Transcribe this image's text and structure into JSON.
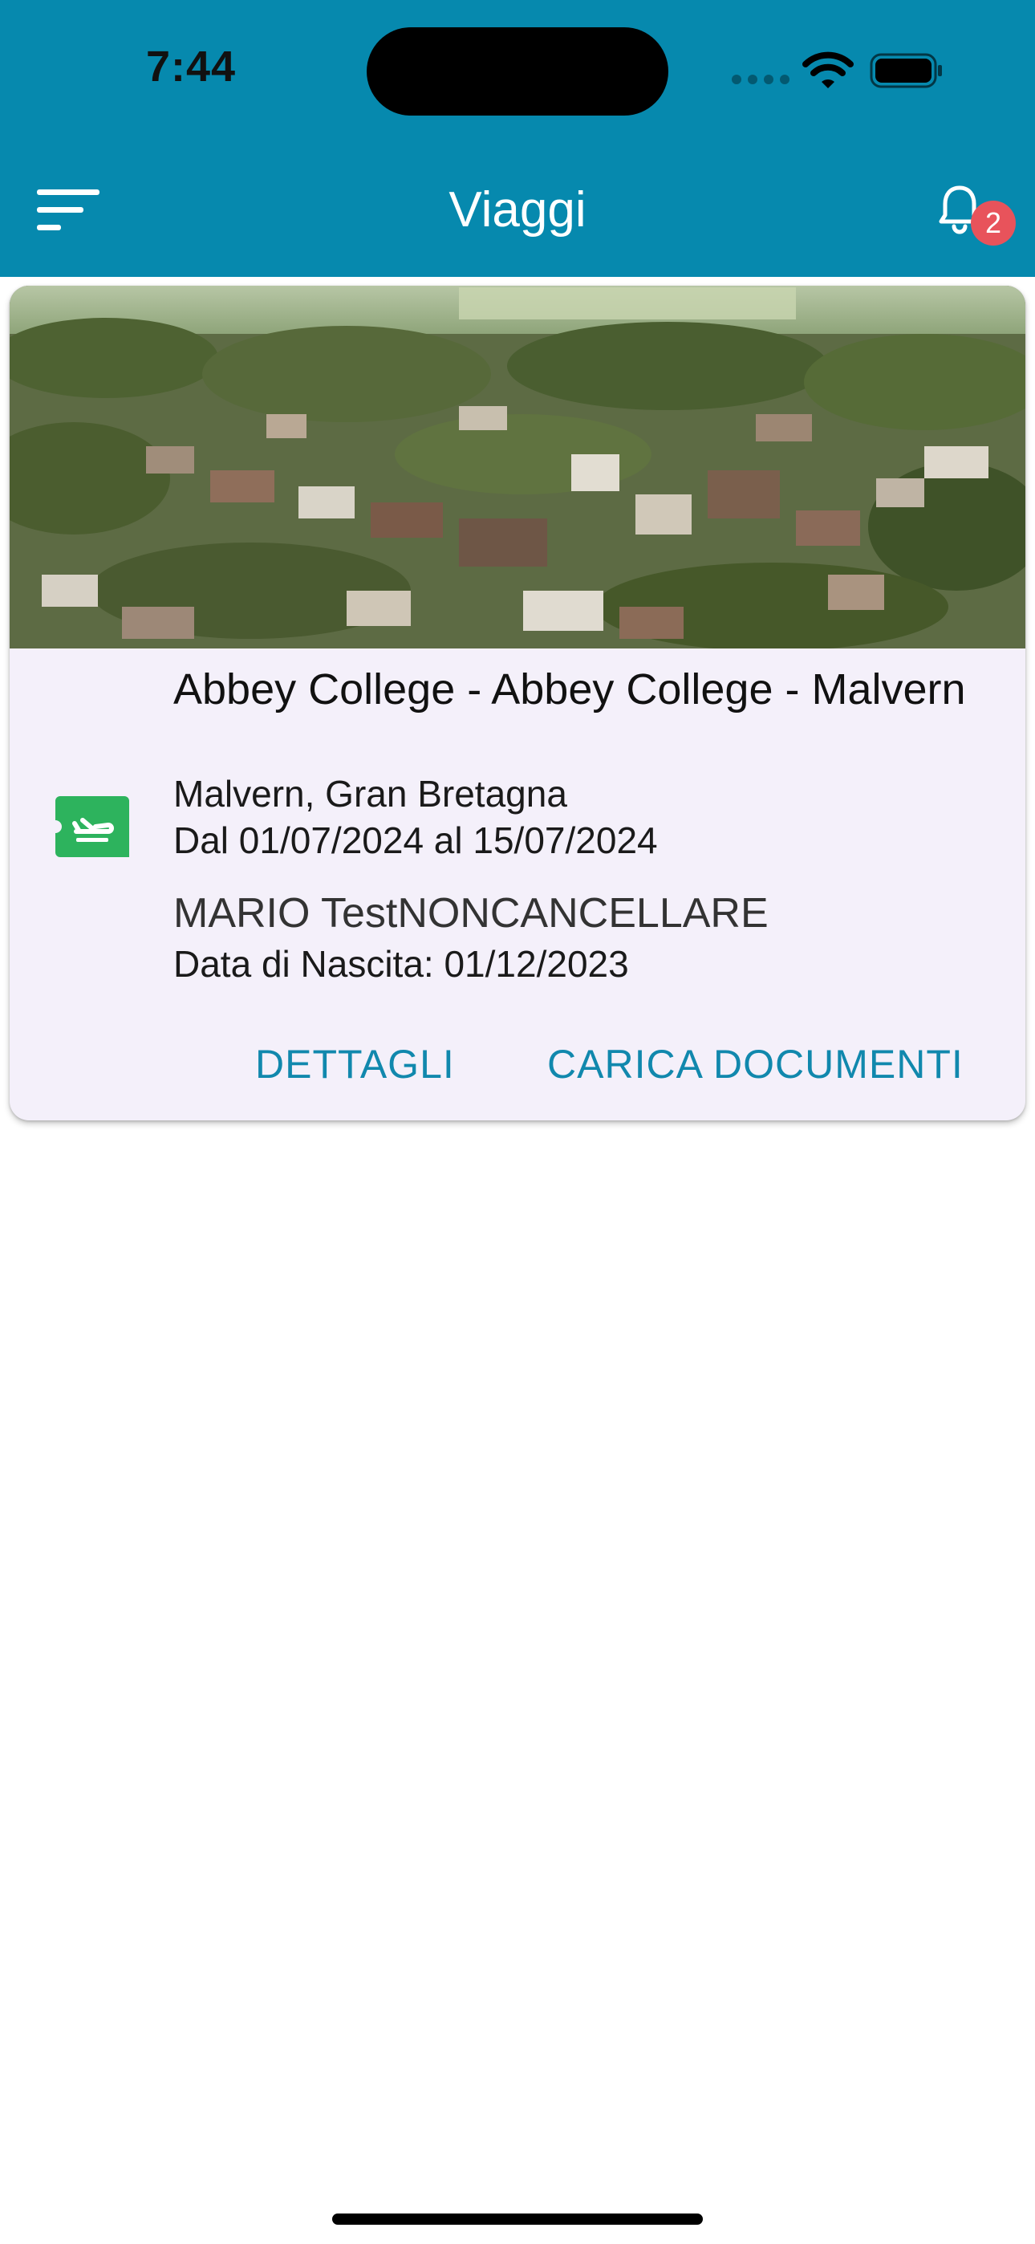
{
  "status_bar": {
    "time": "7:44"
  },
  "header": {
    "title": "Viaggi",
    "notifications_count": "2",
    "background_color": "#0689ae",
    "menu_icon": "menu-sort-icon",
    "bell_icon": "bell-icon"
  },
  "trip": {
    "title": "Abbey College - Abbey College - Malvern",
    "location": "Malvern, Gran Bretagna",
    "dates": "Dal 01/07/2024 al 15/07/2024",
    "traveler_name": "MARIO TestNONCANCELLARE",
    "birth_date": "Data di Nascita: 01/12/2023",
    "icon": "flight-ticket-icon",
    "icon_color": "#2db35d",
    "actions": {
      "details_label": "DETTAGLI",
      "upload_label": "CARICA DOCUMENTI"
    },
    "accent_color": "#1188ad"
  }
}
